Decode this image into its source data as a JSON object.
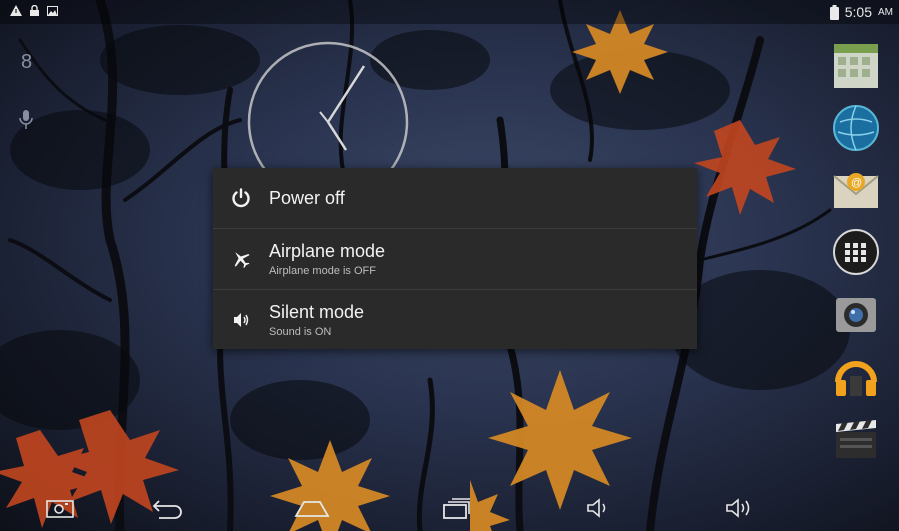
{
  "status_bar": {
    "time": "5:05",
    "ampm": "AM",
    "icons": [
      "warning-icon",
      "lock-icon",
      "image-icon",
      "battery-icon"
    ]
  },
  "dialog": {
    "items": [
      {
        "title": "Power off",
        "subtitle": "",
        "icon": "power-icon"
      },
      {
        "title": "Airplane mode",
        "subtitle": "Airplane mode is OFF",
        "icon": "airplane-icon"
      },
      {
        "title": "Silent mode",
        "subtitle": "Sound is ON",
        "icon": "volume-icon"
      }
    ]
  },
  "dock": [
    "calendar-app-icon",
    "browser-globe-icon",
    "email-app-icon",
    "apps-launcher-icon",
    "camera-app-icon",
    "music-app-icon",
    "movie-app-icon"
  ],
  "nav_bar": [
    "screenshot-icon",
    "back-icon",
    "home-icon",
    "recents-icon",
    "volume-down-icon",
    "volume-up-icon"
  ],
  "colors": {
    "dialog_bg": "#2a2a2a",
    "text": "#f2f2f2",
    "subtext": "#bdbdbd"
  }
}
